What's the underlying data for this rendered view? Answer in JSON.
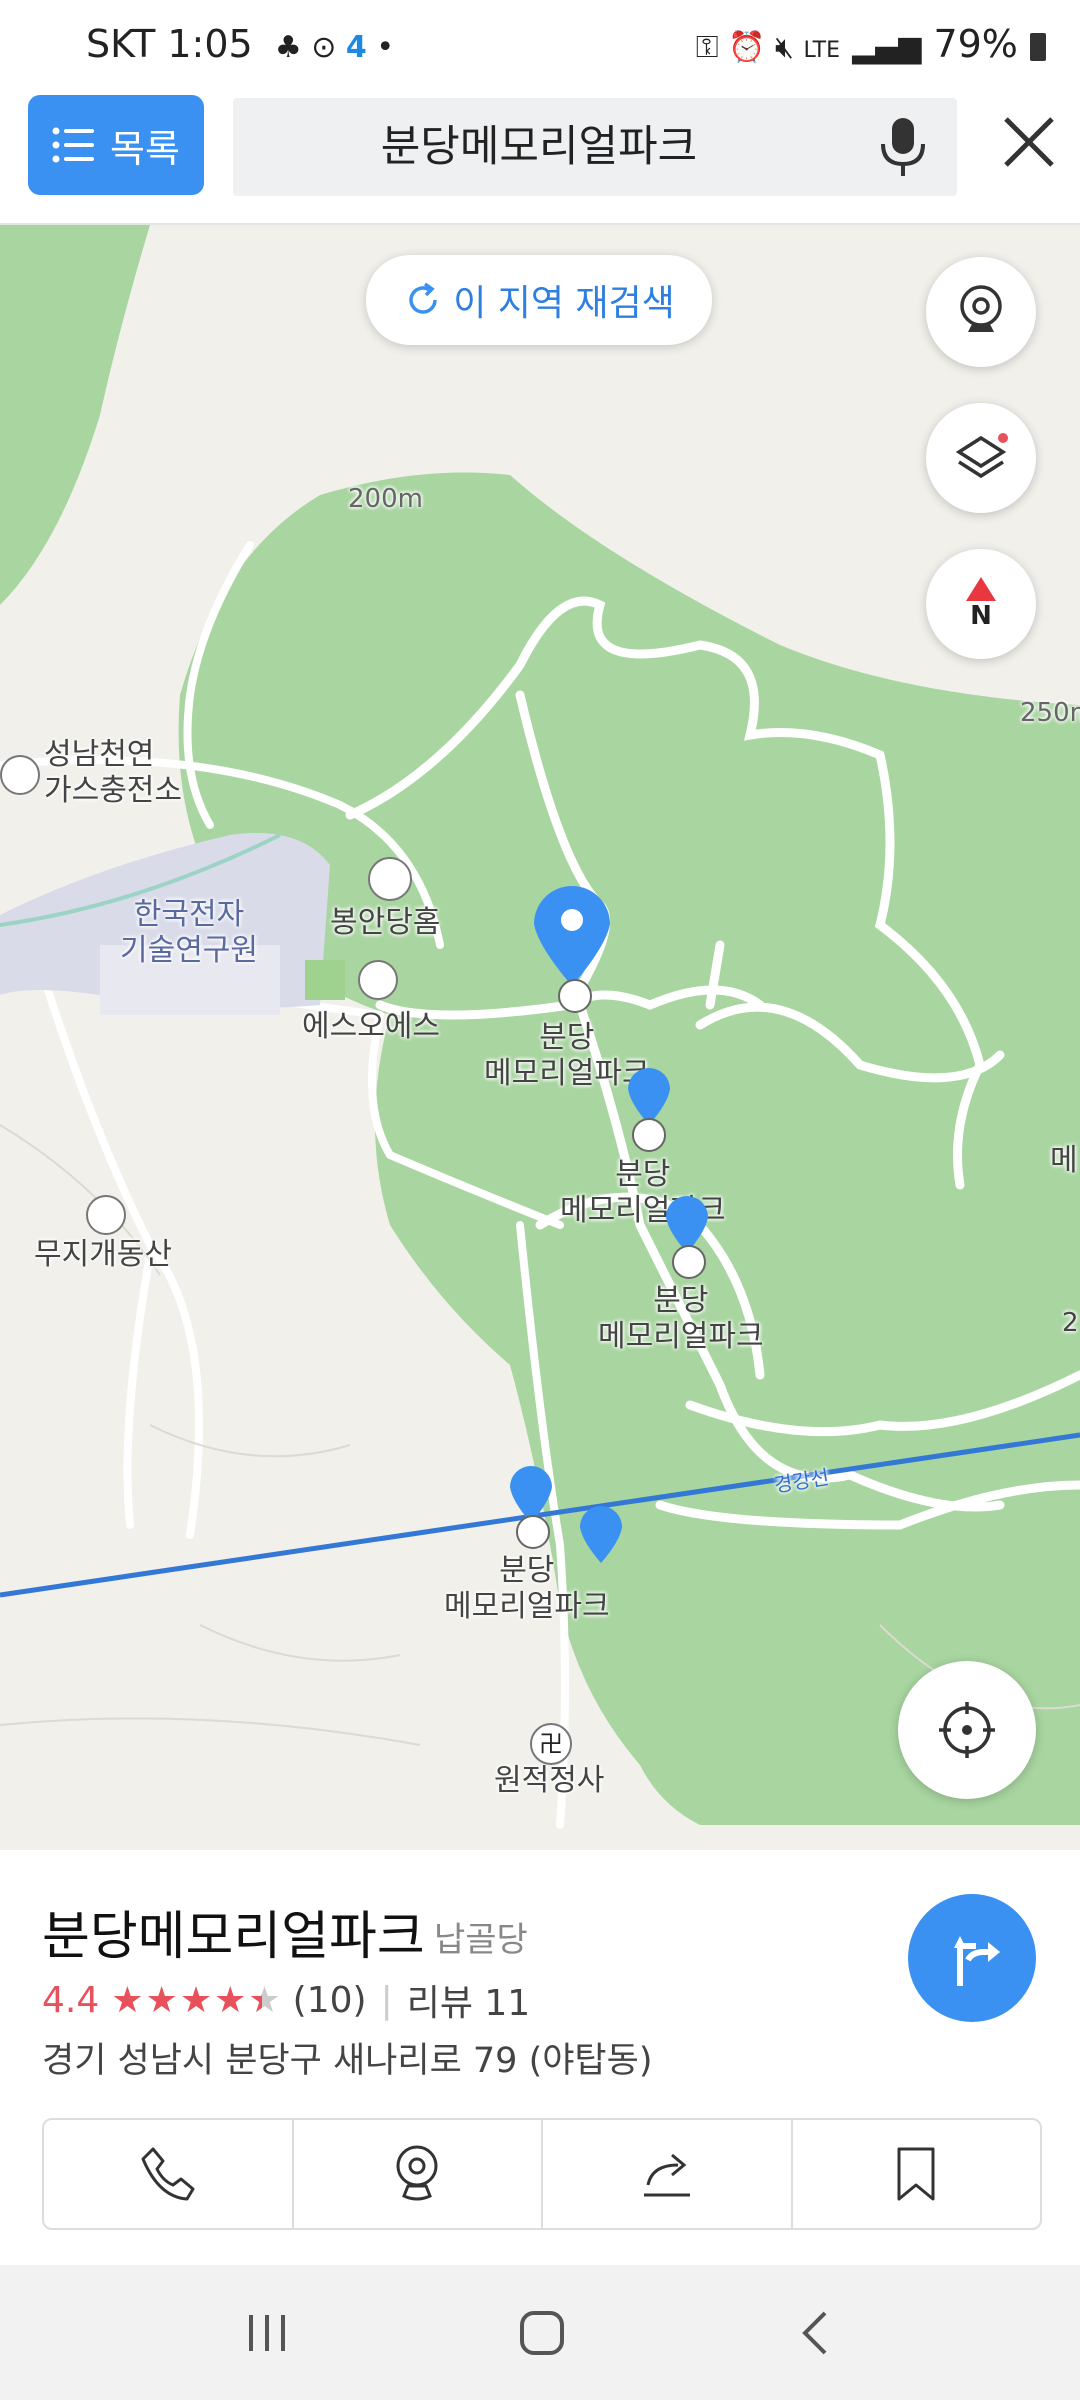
{
  "status_bar": {
    "carrier_time": "SKT 1:05",
    "battery": "79%",
    "network": "LTE"
  },
  "search": {
    "list_label": "목록",
    "query": "분당메모리얼파크"
  },
  "map": {
    "research_label": "이 지역 재검색",
    "compass_label": "N",
    "labels": {
      "gas_station": "성남천연\n가스충전소",
      "institute": "한국전자\n기술연구원",
      "bongan": "봉안당홈",
      "sos": "에스오에스",
      "mountain": "무지개동산",
      "temple": "원적정사",
      "rail": "경강선",
      "contour_200": "200m",
      "contour_250": "250m",
      "edge_label": "메",
      "edge_label2": "2"
    },
    "pins": [
      {
        "label": "분당\n메모리얼파크"
      },
      {
        "label": "분당\n메모리얼파크"
      },
      {
        "label": "분당\n메모리얼파크"
      },
      {
        "label": "분당\n메모리얼파크"
      }
    ]
  },
  "place": {
    "name": "분당메모리얼파크",
    "category": "납골당",
    "rating": "4.4",
    "rating_value": 4.4,
    "rating_count": "(10)",
    "review_label": "리뷰 11",
    "address": "경기 성남시 분당구 새나리로 79 (야탑동)"
  },
  "colors": {
    "accent": "#3a91f2",
    "star": "#e8505b",
    "park": "#a8d5a0",
    "rail": "#3478d6"
  },
  "icons": [
    "list-icon",
    "mic-icon",
    "close-icon",
    "refresh-icon",
    "streetview-icon",
    "layers-icon",
    "compass-icon",
    "locate-icon",
    "route-icon",
    "phone-icon",
    "streetview-icon",
    "share-icon",
    "bookmark-icon",
    "recent-apps-icon",
    "home-icon",
    "back-icon"
  ]
}
